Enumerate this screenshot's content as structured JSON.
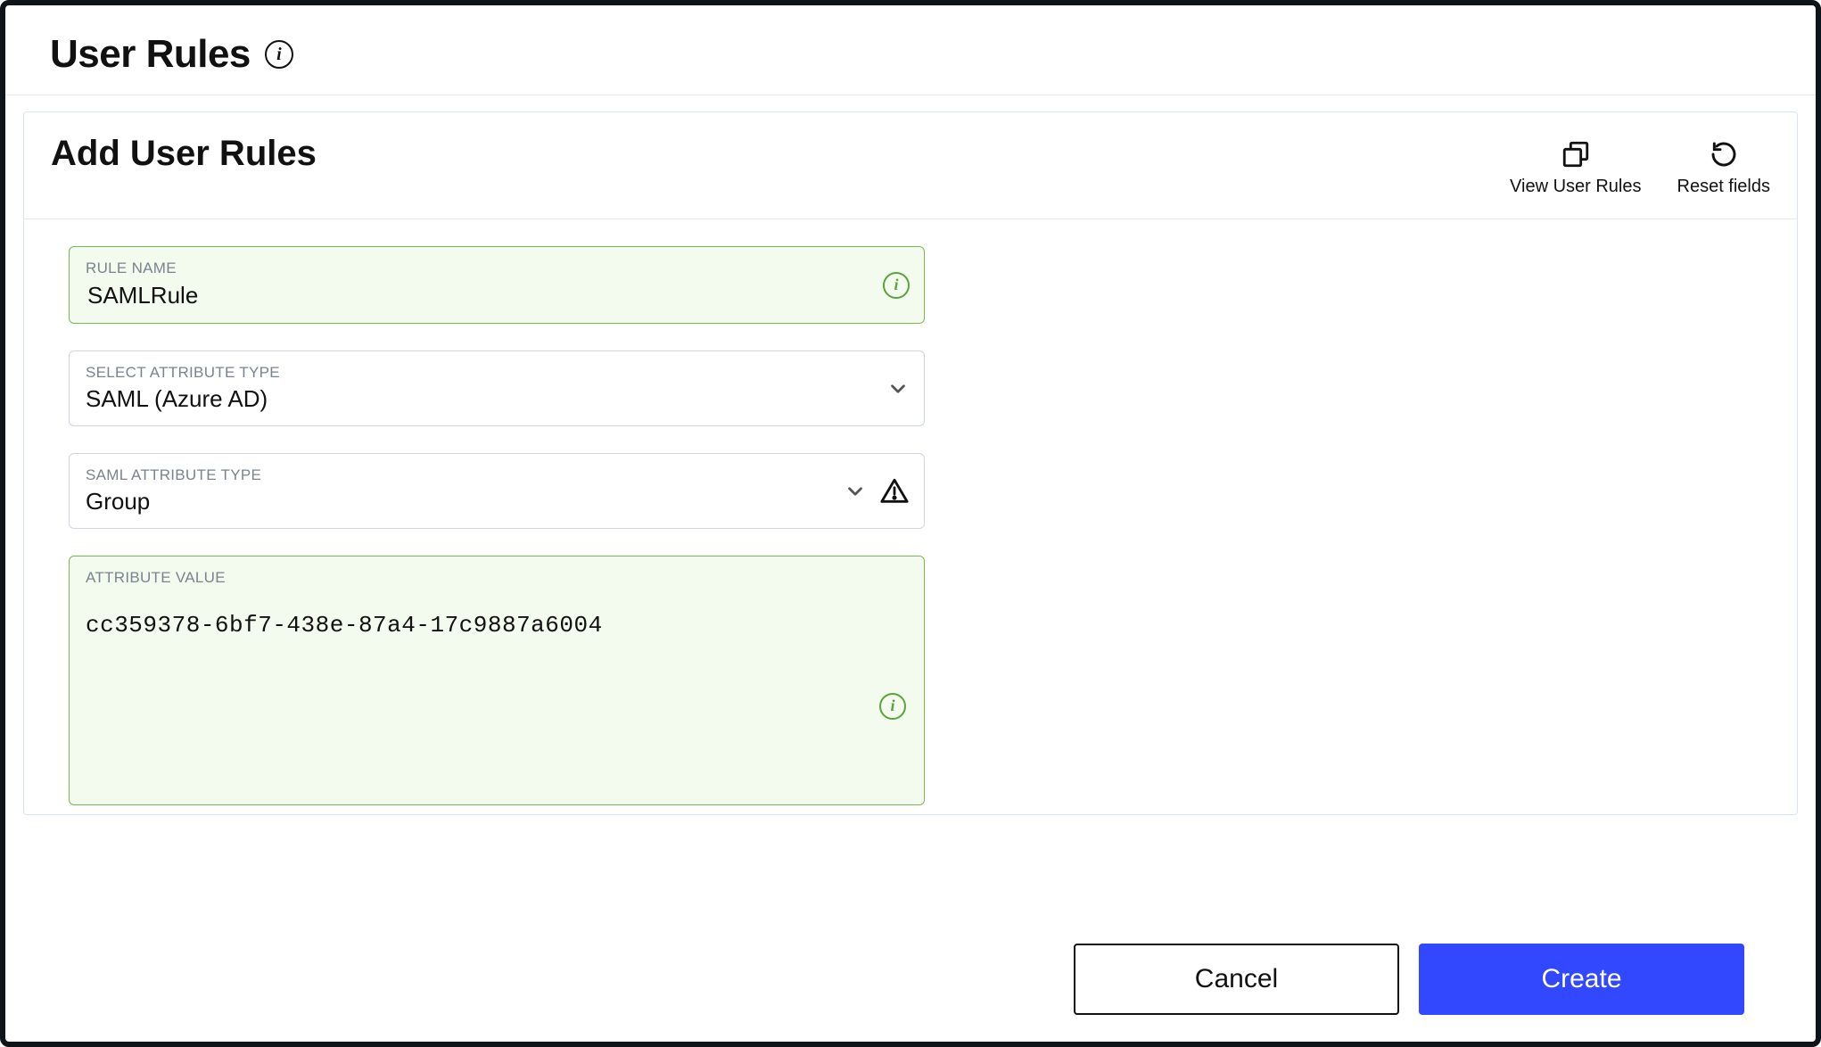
{
  "header": {
    "title": "User Rules"
  },
  "panel": {
    "title": "Add User Rules",
    "actions": {
      "view": "View User Rules",
      "reset": "Reset fields"
    }
  },
  "form": {
    "rule_name": {
      "label": "RULE NAME",
      "value": "SAMLRule"
    },
    "attribute_type": {
      "label": "SELECT ATTRIBUTE TYPE",
      "value": "SAML (Azure AD)"
    },
    "saml_attribute_type": {
      "label": "SAML ATTRIBUTE TYPE",
      "value": "Group"
    },
    "attribute_value": {
      "label": "ATTRIBUTE VALUE",
      "value": "cc359378-6bf7-438e-87a4-17c9887a6004"
    }
  },
  "buttons": {
    "cancel": "Cancel",
    "create": "Create"
  }
}
